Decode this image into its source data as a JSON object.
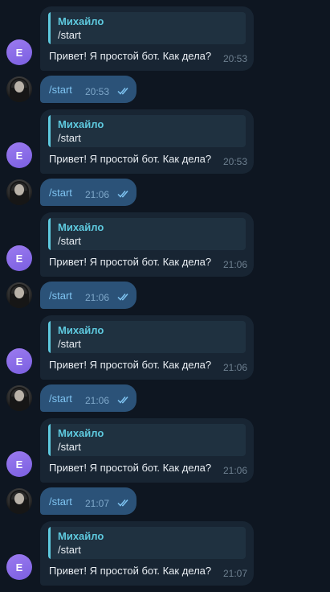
{
  "colors": {
    "background": "#0e1621",
    "incoming_bubble": "#182533",
    "outgoing_bubble": "#2b5278",
    "reply_accent": "#5ec9de",
    "avatar_bot": "#8a6de8"
  },
  "messages": [
    {
      "type": "bot",
      "avatar_letter": "Е",
      "reply_name": "Михайло",
      "reply_text": "/start",
      "text": "Привет! Я простой бот. Как дела?",
      "time": "20:53"
    },
    {
      "type": "user",
      "text": "/start",
      "time": "20:53",
      "status_icon": "double-check-icon"
    },
    {
      "type": "bot",
      "avatar_letter": "Е",
      "reply_name": "Михайло",
      "reply_text": "/start",
      "text": "Привет! Я простой бот. Как дела?",
      "time": "20:53"
    },
    {
      "type": "user",
      "text": "/start",
      "time": "21:06",
      "status_icon": "double-check-icon"
    },
    {
      "type": "bot",
      "avatar_letter": "Е",
      "reply_name": "Михайло",
      "reply_text": "/start",
      "text": "Привет! Я простой бот. Как дела?",
      "time": "21:06"
    },
    {
      "type": "user",
      "text": "/start",
      "time": "21:06",
      "status_icon": "double-check-icon"
    },
    {
      "type": "bot",
      "avatar_letter": "Е",
      "reply_name": "Михайло",
      "reply_text": "/start",
      "text": "Привет! Я простой бот. Как дела?",
      "time": "21:06"
    },
    {
      "type": "user",
      "text": "/start",
      "time": "21:06",
      "status_icon": "double-check-icon"
    },
    {
      "type": "bot",
      "avatar_letter": "Е",
      "reply_name": "Михайло",
      "reply_text": "/start",
      "text": "Привет! Я простой бот. Как дела?",
      "time": "21:06"
    },
    {
      "type": "user",
      "text": "/start",
      "time": "21:07",
      "status_icon": "double-check-icon"
    },
    {
      "type": "bot",
      "avatar_letter": "Е",
      "reply_name": "Михайло",
      "reply_text": "/start",
      "text": "Привет! Я простой бот. Как дела?",
      "time": "21:07"
    }
  ]
}
